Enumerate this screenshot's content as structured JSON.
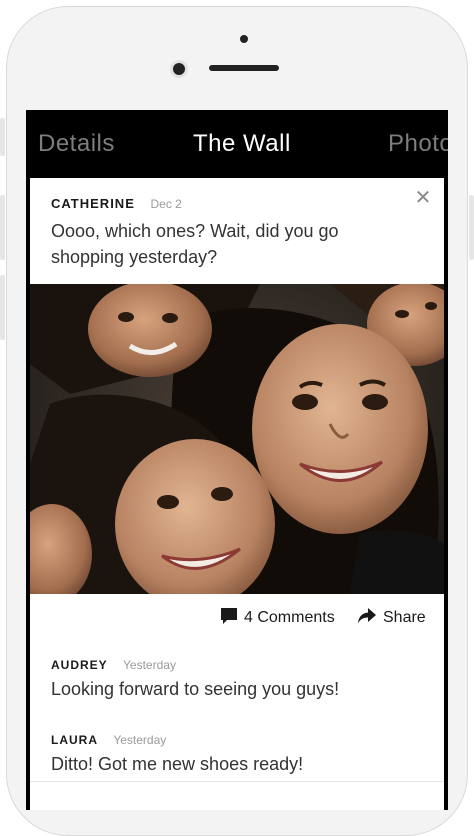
{
  "nav": {
    "tabs": [
      {
        "label": "Details",
        "state": "inactive"
      },
      {
        "label": "The Wall",
        "state": "active"
      },
      {
        "label": "Photo",
        "state": "inactive"
      }
    ]
  },
  "post": {
    "author": "CATHERINE",
    "date": "Dec 2",
    "close_icon": "close-icon",
    "text": "Oooo, which ones? Wait, did you go shopping yesterday?",
    "photo_alt": "group-selfie-photo"
  },
  "actions": {
    "comments_label": "4 Comments",
    "comments_icon": "comment-bubble-icon",
    "share_label": "Share",
    "share_icon": "share-arrow-icon"
  },
  "comments": [
    {
      "author": "AUDREY",
      "date": "Yesterday",
      "text": "Looking forward to seeing you guys!"
    },
    {
      "author": "LAURA",
      "date": "Yesterday",
      "text": "Ditto! Got me new shoes ready!"
    }
  ],
  "colors": {
    "nav_background": "#000000",
    "active_tab": "#ffffff",
    "inactive_tab": "#7d7d7d",
    "meta_text": "#9a9a9a",
    "body_text": "#333333"
  }
}
